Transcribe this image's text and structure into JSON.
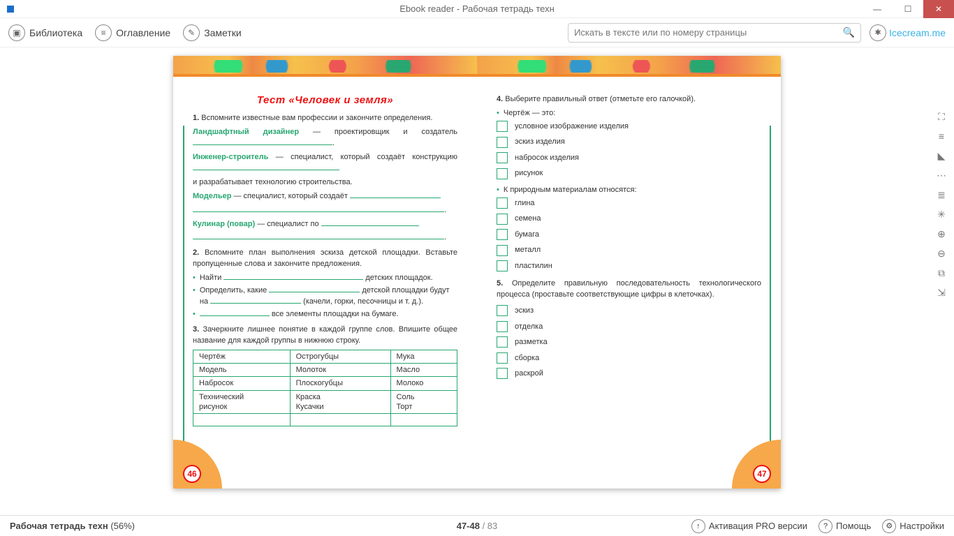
{
  "window": {
    "title": "Ebook reader - Рабочая тетрадь техн"
  },
  "toolbar": {
    "library": "Библиотека",
    "toc": "Оглавление",
    "notes": "Заметки",
    "search_ph": "Искать в тексте или по номеру страницы",
    "brand": "Icecream.me"
  },
  "left_page": {
    "num": "46",
    "title": "Тест «Человек и земля»",
    "q1": "1.",
    "q1_text": "Вспомните известные вам профессии и закончите определения.",
    "t1": "Ландшафтный дизайнер",
    "t1_rest": " — проектировщик и созда­тель ",
    "t2": "Инженер-строитель",
    "t2_rest": " — специалист, который создаёт конструкцию ",
    "t2_tail": "и разрабатывает технологию строительства.",
    "t3": "Модельер",
    "t3_rest": " — специалист, который создаёт ",
    "t4": "Кулинар (повар)",
    "t4_rest": " — специалист по ",
    "q2": "2.",
    "q2_text": "Вспомните план выполнения эскиза детской пло­щадки. Вставьте пропущенные слова и закончите пред­ложения.",
    "b1_a": "Найти ",
    "b1_b": " детских площадок.",
    "b2_a": "Определить, какие ",
    "b2_b": " детской площадки будут на ",
    "b2_c": " (качели, горки, песочницы и т. д.).",
    "b3_a": "",
    "b3_b": " все элементы площадки на бумаге.",
    "q3": "3.",
    "q3_text": "Зачеркните лишнее понятие в каждой группе слов. Впишите общее название для каждой группы в нижнюю строку.",
    "table": {
      "c1": [
        "Чертёж",
        "Модель",
        "Набросок",
        "Технический",
        "рисунок"
      ],
      "c2": [
        "Острогубцы",
        "Молоток",
        "Плоскогубцы",
        "Краска",
        "Кусачки"
      ],
      "c3": [
        "Мука",
        "Масло",
        "Молоко",
        "Соль",
        "Торт"
      ]
    }
  },
  "right_page": {
    "num": "47",
    "q4": "4.",
    "q4_text": "Выберите правильный ответ (отметьте его галочкой).",
    "h1": "Чертёж — это:",
    "opts1": [
      "условное изображение изделия",
      "эскиз изделия",
      "набросок изделия",
      "рисунок"
    ],
    "h2": "К природным материалам относятся:",
    "opts2": [
      "глина",
      "семена",
      "бумага",
      "металл",
      "пластилин"
    ],
    "q5": "5.",
    "q5_text": "Определите правильную последовательность тех­нологического процесса (проставьте соответствующие цифры в клеточках).",
    "opts3": [
      "эскиз",
      "отделка",
      "разметка",
      "сборка",
      "раскрой"
    ]
  },
  "status": {
    "book": "Рабочая тетрадь техн",
    "pct": "(56%)",
    "pages": "47-48",
    "total": " / 83",
    "pro": "Активация PRO версии",
    "help": "Помощь",
    "settings": "Настройки"
  }
}
